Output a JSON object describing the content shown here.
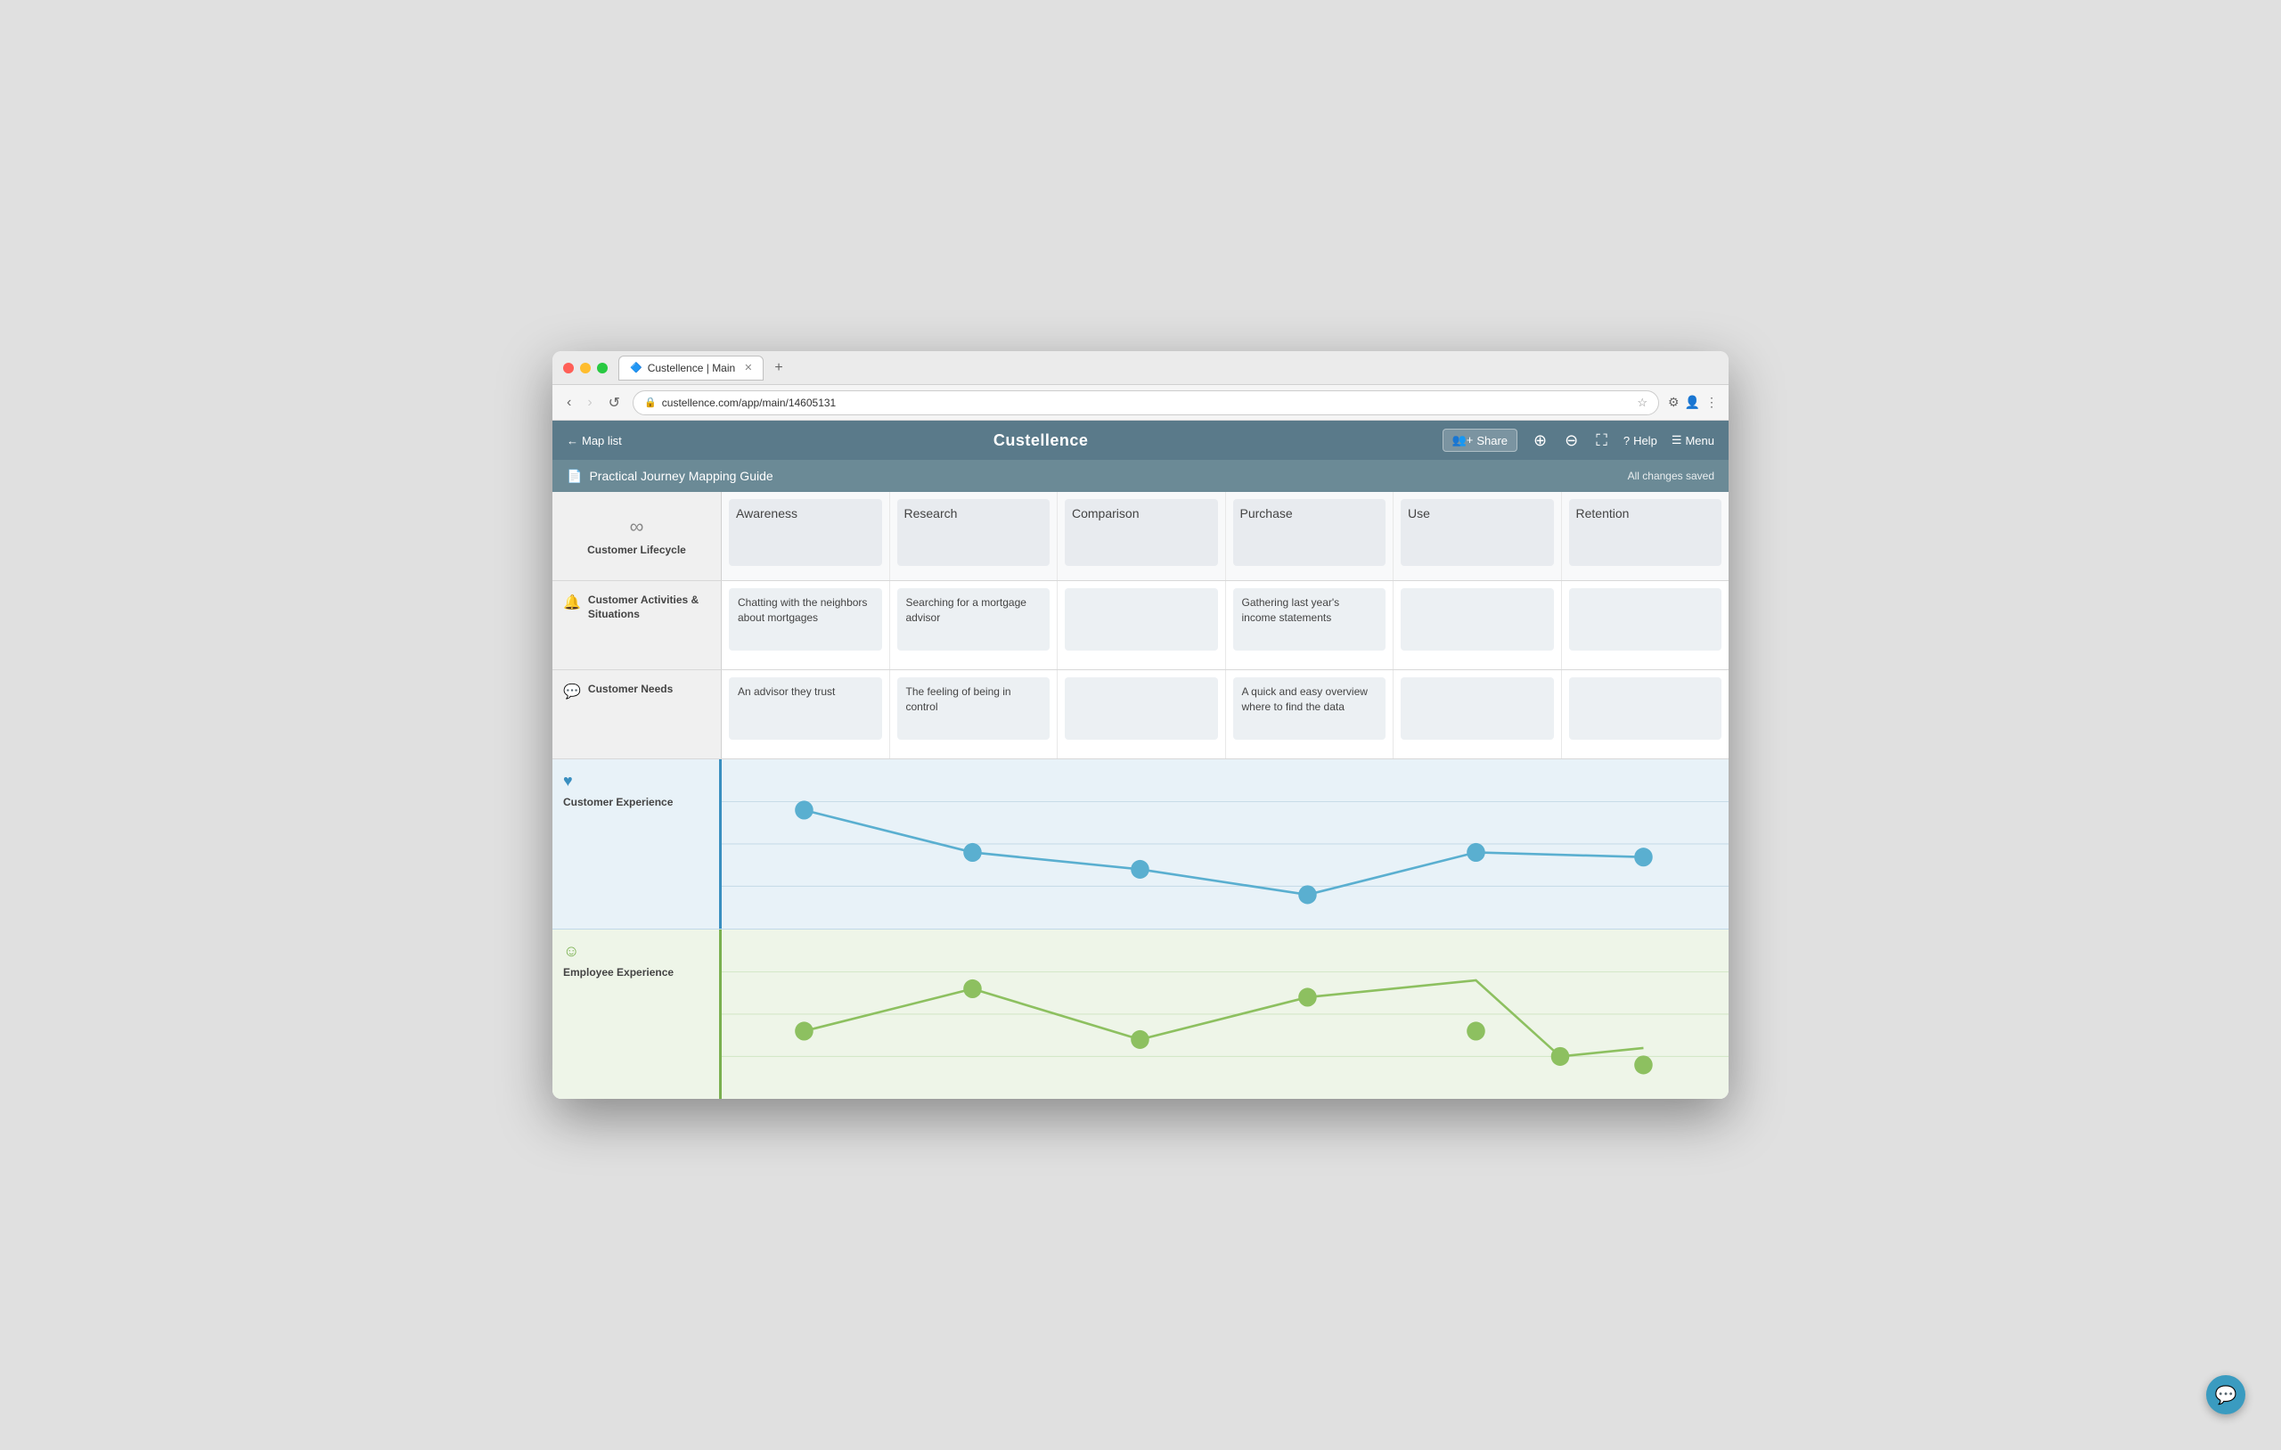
{
  "browser": {
    "tab_title": "Custellence | Main",
    "url": "custellence.com/app/main/14605131",
    "new_tab_label": "+"
  },
  "app_nav": {
    "back_label": "Map list",
    "title": "Custellence",
    "share_label": "Share",
    "help_label": "Help",
    "menu_label": "Menu"
  },
  "document": {
    "title": "Practical Journey Mapping Guide",
    "status": "All changes saved"
  },
  "lifecycle": {
    "row_label": "Customer Lifecycle",
    "stages": [
      "Awareness",
      "Research",
      "Comparison",
      "Purchase",
      "Use",
      "Retention"
    ]
  },
  "activities": {
    "row_label": "Customer Activities & Situations",
    "icon": "person",
    "cards": [
      {
        "col": 0,
        "text": "Chatting with the neighbors about mortgages"
      },
      {
        "col": 1,
        "text": "Searching for a mortgage advisor"
      },
      {
        "col": 2,
        "text": ""
      },
      {
        "col": 3,
        "text": "Gathering last year's income statements"
      },
      {
        "col": 4,
        "text": ""
      },
      {
        "col": 5,
        "text": ""
      }
    ]
  },
  "needs": {
    "row_label": "Customer Needs",
    "icon": "chat",
    "cards": [
      {
        "col": 0,
        "text": "An advisor they trust"
      },
      {
        "col": 1,
        "text": "The feeling of being in control"
      },
      {
        "col": 2,
        "text": ""
      },
      {
        "col": 3,
        "text": "A quick and easy overview where to find the data"
      },
      {
        "col": 4,
        "text": ""
      },
      {
        "col": 5,
        "text": ""
      }
    ]
  },
  "customer_experience": {
    "row_label": "Customer Experience",
    "icon": "heart",
    "points": [
      {
        "x": 0,
        "y": 30
      },
      {
        "x": 1,
        "y": 55
      },
      {
        "x": 2,
        "y": 65
      },
      {
        "x": 3,
        "y": 80
      },
      {
        "x": 4,
        "y": 55
      },
      {
        "x": 5,
        "y": 58
      }
    ]
  },
  "employee_experience": {
    "row_label": "Employee Experience",
    "icon": "smiley",
    "points": [
      {
        "x": 0,
        "y": 60
      },
      {
        "x": 1,
        "y": 35
      },
      {
        "x": 2,
        "y": 65
      },
      {
        "x": 3,
        "y": 40
      },
      {
        "x": 4,
        "y": 30
      },
      {
        "x": 5,
        "y": 75
      },
      {
        "x": 6,
        "y": 70
      }
    ]
  },
  "chat_button": {
    "icon": "💬"
  }
}
